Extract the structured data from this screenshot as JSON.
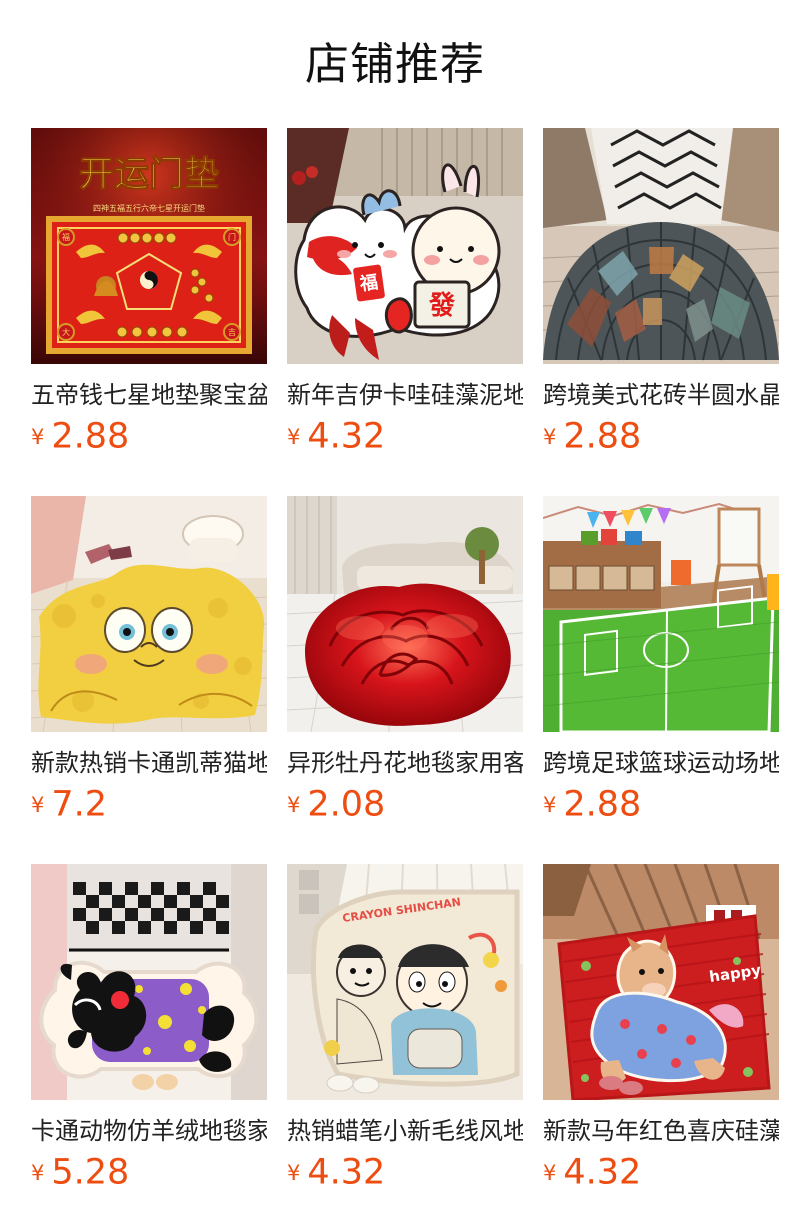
{
  "page": {
    "title": "店铺推荐"
  },
  "colors": {
    "price": "#ee4d11",
    "title": "#111111",
    "product_text": "#222222",
    "background": "#ffffff"
  },
  "products": [
    {
      "name": "五帝钱七星地垫聚宝盆",
      "currency": "¥",
      "price": "2.88",
      "image": {
        "icon": "red-feng-shui-door-mat-image",
        "title": "开运门垫",
        "subtitle": "四神五福五行六帝七星开运门垫",
        "corner_labels": [
          "福",
          "门",
          "大",
          "吉"
        ]
      }
    },
    {
      "name": "新年吉伊卡哇硅藻泥地垫",
      "currency": "¥",
      "price": "4.32",
      "image": {
        "icon": "cartoon-rabbit-bear-mat-image",
        "labels": [
          "福",
          "發"
        ]
      }
    },
    {
      "name": "跨境美式花砖半圆水晶绒",
      "currency": "¥",
      "price": "2.88",
      "image": {
        "icon": "semicircle-tile-pattern-mat-image"
      }
    },
    {
      "name": "新款热销卡通凯蒂猫地垫",
      "currency": "¥",
      "price": "7.2",
      "image": {
        "icon": "yellow-sponge-cartoon-mat-image"
      }
    },
    {
      "name": "异形牡丹花地毯家用客厅",
      "currency": "¥",
      "price": "2.08",
      "image": {
        "icon": "red-peony-rose-rug-image"
      }
    },
    {
      "name": "跨境足球篮球运动场地毯",
      "currency": "¥",
      "price": "2.88",
      "image": {
        "icon": "soccer-field-rug-image"
      }
    },
    {
      "name": "卡通动物仿羊绒地毯家用",
      "currency": "¥",
      "price": "5.28",
      "image": {
        "icon": "black-cartoon-animal-purple-mat-image"
      }
    },
    {
      "name": "热销蜡笔小新毛线风地毯",
      "currency": "¥",
      "price": "4.32",
      "image": {
        "icon": "crayon-shinchan-mat-image",
        "label": "CRAYON SHINCHAN"
      }
    },
    {
      "name": "新款马年红色喜庆硅藻泥",
      "currency": "¥",
      "price": "4.32",
      "image": {
        "icon": "red-happy-horse-mat-image",
        "label": "happy"
      }
    }
  ]
}
